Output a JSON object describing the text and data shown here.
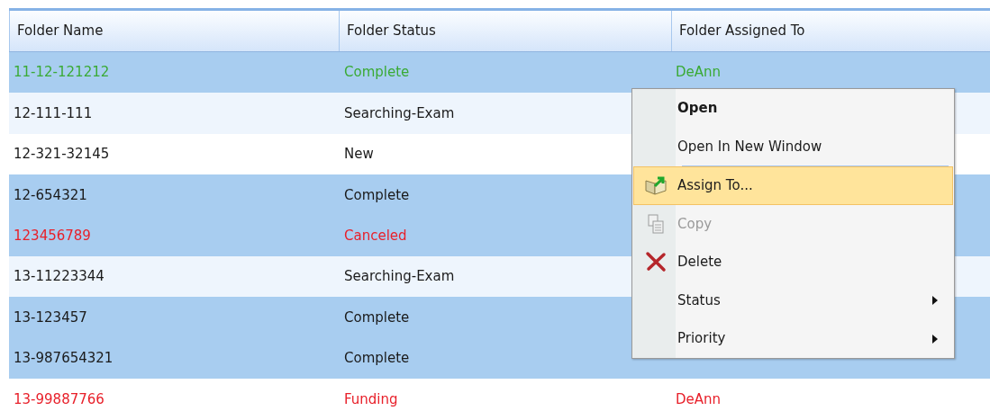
{
  "table": {
    "columns": [
      "Folder Name",
      "Folder Status",
      "Folder Assigned To"
    ],
    "rows": [
      {
        "cells": [
          "11-12-121212",
          "Complete",
          "DeAnn"
        ],
        "selected": true,
        "color": "#3aaa35"
      },
      {
        "cells": [
          "12-111-111",
          "Searching-Exam"
        ],
        "selected": false,
        "color": "#1a1a1a"
      },
      {
        "cells": [
          "12-321-32145",
          "New"
        ],
        "selected": false,
        "color": "#1a1a1a"
      },
      {
        "cells": [
          "12-654321",
          "Complete"
        ],
        "selected": true,
        "color": "#1a1a1a"
      },
      {
        "cells": [
          "123456789",
          "Canceled"
        ],
        "selected": true,
        "color": "#e8202a"
      },
      {
        "cells": [
          "13-11223344",
          "Searching-Exam"
        ],
        "selected": false,
        "color": "#1a1a1a"
      },
      {
        "cells": [
          "13-123457",
          "Complete"
        ],
        "selected": true,
        "color": "#1a1a1a"
      },
      {
        "cells": [
          "13-987654321",
          "Complete"
        ],
        "selected": true,
        "color": "#1a1a1a"
      },
      {
        "cells": [
          "13-99887766",
          "Funding",
          "DeAnn"
        ],
        "selected": false,
        "color": "#e8202a"
      }
    ]
  },
  "context_menu": {
    "items": [
      {
        "label": "Open",
        "kind": "default",
        "selected": false,
        "disabled": false
      },
      {
        "label": "Open In New Window",
        "kind": "plain",
        "selected": false,
        "disabled": false
      },
      {
        "kind": "separator"
      },
      {
        "label": "Assign To...",
        "kind": "assign",
        "selected": true,
        "disabled": false
      },
      {
        "label": "Copy",
        "kind": "copy",
        "selected": false,
        "disabled": true
      },
      {
        "label": "Delete",
        "kind": "delete",
        "selected": false,
        "disabled": false
      },
      {
        "label": "Status",
        "kind": "submenu",
        "selected": false,
        "disabled": false
      },
      {
        "label": "Priority",
        "kind": "submenu",
        "selected": false,
        "disabled": false
      }
    ]
  }
}
